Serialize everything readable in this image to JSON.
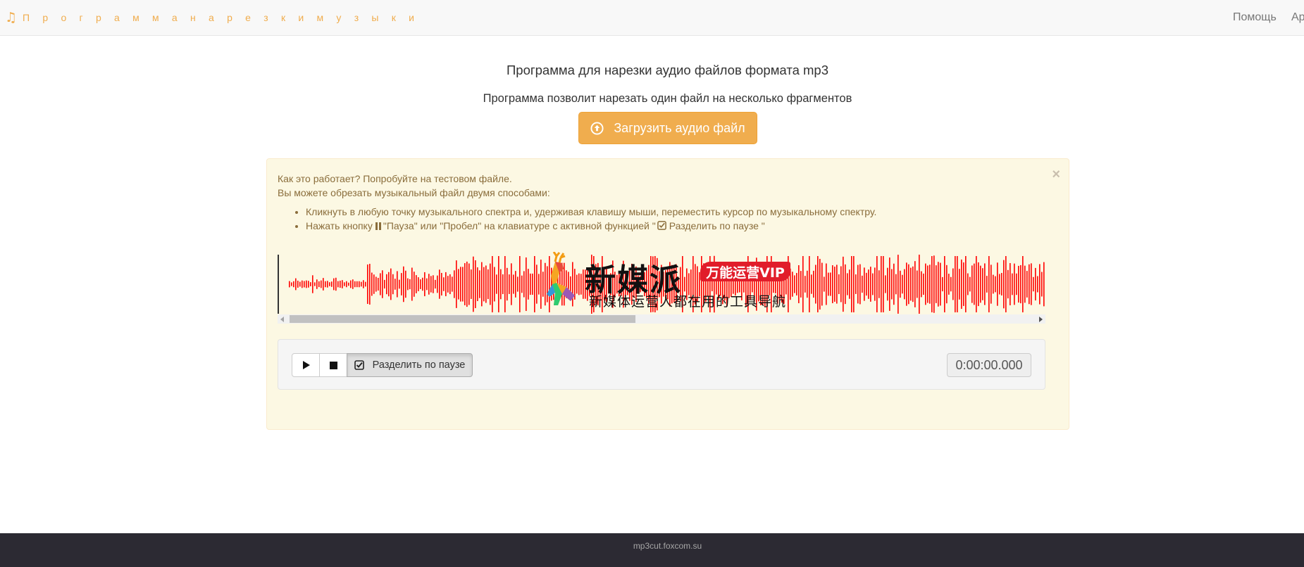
{
  "navbar": {
    "brand_icon": "music-note-icon",
    "brand": "П р о г р а м м а   н а р е з к и   м у з ы к и",
    "links": [
      "Помощь",
      "Ар"
    ]
  },
  "main": {
    "title": "Программа для нарезки аудио файлов формата mp3",
    "subtitle": "Программа позволит нарезать один файл на несколько фрагментов",
    "upload_label": "Загрузить аудио файл",
    "upload_icon": "upload-circle-icon",
    "accent_color": "#f0ad4e"
  },
  "help": {
    "close": "×",
    "line1": "Как это работает? Попробуйте на тестовом файле.",
    "line2": "Вы можете обрезать музыкальный файл двумя способами:",
    "step1": "Кликнуть в любую точку музыкального спектра и, удерживая клавишу мыши, переместить курсор по музыкальному спектру.",
    "step2_a": "Нажать кнопку",
    "step2_b": "\"Пауза\" или \"Пробел\" на клавиатуре с активной функцией \"",
    "step2_c": "Разделить по паузе \""
  },
  "waveform": {
    "color": "#ff0000",
    "scroll_position": 0.45
  },
  "watermark": {
    "title": "新媒派",
    "badge": "万能运营VIP",
    "subtitle": "新媒体运营人都在用的工具导航"
  },
  "player": {
    "play_icon": "play-icon",
    "stop_icon": "stop-icon",
    "split_label": "Разделить по паузе",
    "split_icon": "checkbox-checked-icon",
    "time": "0:00:00.000"
  },
  "footer": {
    "text": "mp3cut.foxcom.su"
  }
}
